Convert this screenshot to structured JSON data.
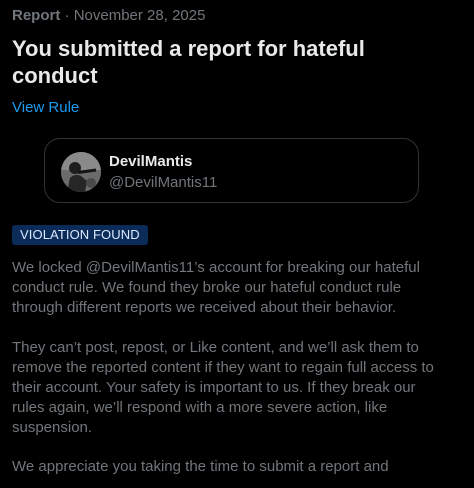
{
  "header": {
    "label": "Report",
    "separator": " · ",
    "date": "November 28, 2025"
  },
  "title": "You submitted a report for hateful conduct",
  "view_rule_label": "View Rule",
  "account": {
    "display_name": "DevilMantis",
    "handle": "@DevilMantis11",
    "avatar_icon": "profile-photo"
  },
  "badge": {
    "label": "VIOLATION FOUND",
    "background": "#0b2b59",
    "text_color": "#dbe8ff"
  },
  "body": {
    "paragraph1": "We locked @DevilMantis11’s account for breaking our hateful conduct rule. We found they broke our hateful conduct rule through different reports we received about their behavior.",
    "paragraph2": "They can’t post, repost, or Like content, and we’ll ask them to remove the reported content if they want to regain full access to their account. Your safety is important to us. If they break our rules again, we’ll respond with a more severe action, like suspension.",
    "paragraph3": "We appreciate you taking the time to submit a report and"
  },
  "colors": {
    "background": "#000000",
    "primary_text": "#e7e9ea",
    "secondary_text": "#71767b",
    "link": "#1d9bf0",
    "card_border": "#2f3336"
  }
}
